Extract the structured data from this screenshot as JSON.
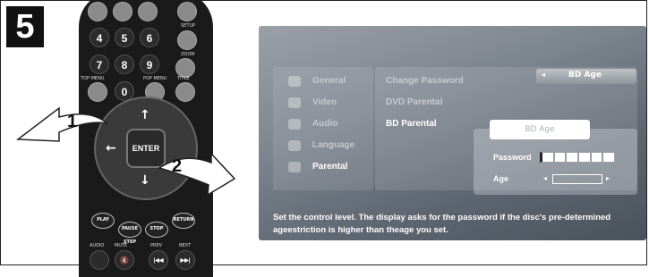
{
  "step_number": "5",
  "remote": {
    "number_buttons": [
      "4",
      "5",
      "6",
      "7",
      "8",
      "9",
      "0"
    ],
    "labels": {
      "setup": "SETUP",
      "zoom": "ZOOM",
      "top_menu": "TOP MENU",
      "pop_menu": "POP MENU",
      "title": "TITLE",
      "audio": "AUDIO",
      "mute": "MUTE",
      "prev": "PREV",
      "next": "NEXT"
    },
    "enter_label": "ENTER",
    "arrows": {
      "up": "↑",
      "down": "↓",
      "left": "←"
    },
    "pills": {
      "play": "PLAY",
      "pause": "PAUSE STEP",
      "stop": "STOP",
      "return": "RETURN"
    },
    "transport": {
      "prev": "|◀◀",
      "next": "▶▶|",
      "mute": "🔇"
    }
  },
  "callouts": {
    "one": "1",
    "two": "2"
  },
  "tv": {
    "menu_items": [
      {
        "label": "General"
      },
      {
        "label": "Video"
      },
      {
        "label": "Audio"
      },
      {
        "label": "Language"
      },
      {
        "label": "Parental"
      }
    ],
    "options": [
      {
        "label": "Change Password"
      },
      {
        "label": "DVD Parental"
      },
      {
        "label": "BD Parental"
      }
    ],
    "bd_age_top": "BD Age",
    "bd_age_arrow": "◂",
    "bd_age_button": "BD Age",
    "password_label": "Password",
    "age_label": "Age",
    "age_arrows": {
      "left": "◂",
      "right": "▸"
    },
    "description": "Set  the control level. The display asks for the password if the disc's pre-determined ageestriction is higher than theage you set."
  }
}
